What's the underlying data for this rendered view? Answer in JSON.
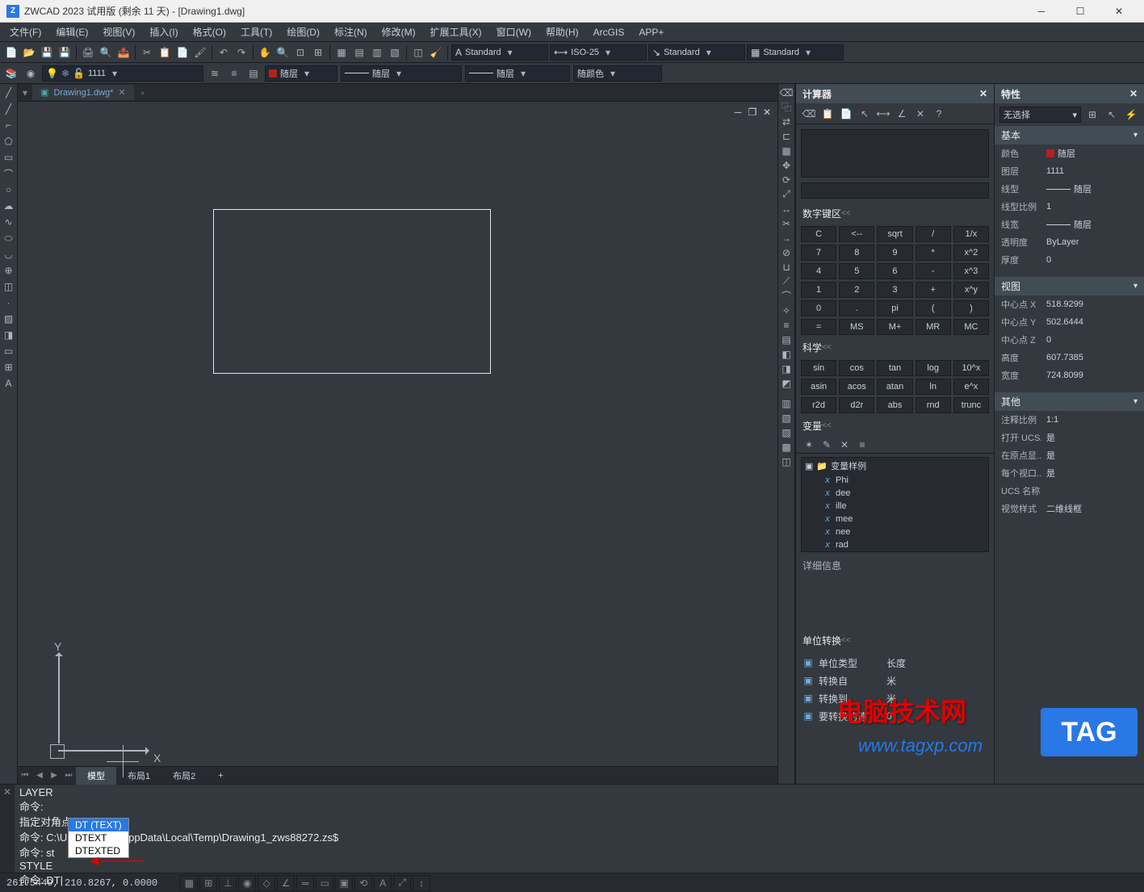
{
  "title": "ZWCAD 2023 试用版 (剩余 11 天) - [Drawing1.dwg]",
  "menus": [
    "文件(F)",
    "编辑(E)",
    "视图(V)",
    "插入(I)",
    "格式(O)",
    "工具(T)",
    "绘图(D)",
    "标注(N)",
    "修改(M)",
    "扩展工具(X)",
    "窗口(W)",
    "帮助(H)",
    "ArcGIS",
    "APP+"
  ],
  "toolbar_styles": {
    "text": "Standard",
    "dim": "ISO-25",
    "mleader": "Standard",
    "table": "Standard"
  },
  "layer_bar": {
    "layer": "1111",
    "color": "随层",
    "linetype": "随层",
    "lineweight": "随层",
    "plot": "随颜色"
  },
  "doc_tab": {
    "name": "Drawing1.dwg*"
  },
  "model_tabs": {
    "model": "模型",
    "layout1": "布局1",
    "layout2": "布局2"
  },
  "calc": {
    "title": "计算器",
    "sections": {
      "numpad": "数字键区",
      "science": "科学",
      "vars": "变量",
      "detail": "详细信息",
      "unit": "单位转换"
    },
    "keys": [
      [
        "C",
        "<--",
        "sqrt",
        "/",
        "1/x"
      ],
      [
        "7",
        "8",
        "9",
        "*",
        "x^2"
      ],
      [
        "4",
        "5",
        "6",
        "-",
        "x^3"
      ],
      [
        "1",
        "2",
        "3",
        "+",
        "x^y"
      ],
      [
        "0",
        ".",
        "pi",
        "(",
        ")"
      ],
      [
        "=",
        "MS",
        "M+",
        "MR",
        "MC"
      ]
    ],
    "sci_keys": [
      [
        "sin",
        "cos",
        "tan",
        "log",
        "10^x"
      ],
      [
        "asin",
        "acos",
        "atan",
        "ln",
        "e^x"
      ],
      [
        "r2d",
        "d2r",
        "abs",
        "rnd",
        "trunc"
      ]
    ],
    "var_tree": {
      "root": "变量样例",
      "items": [
        "Phi",
        "dee",
        "ille",
        "mee",
        "nee",
        "rad"
      ]
    },
    "unit_rows": {
      "type_label": "单位类型",
      "type_val": "长度",
      "from_label": "转换自",
      "from_val": "米",
      "to_label": "转换到",
      "to_val": "米",
      "val_label": "要转换的值",
      "val_val": "0"
    }
  },
  "props": {
    "title": "特性",
    "selector": "无选择",
    "sections": {
      "basic": {
        "title": "基本",
        "rows": [
          {
            "label": "颜色",
            "val": "随层",
            "swatch": true
          },
          {
            "label": "图层",
            "val": "1111"
          },
          {
            "label": "线型",
            "val": "随层",
            "line": true
          },
          {
            "label": "线型比例",
            "val": "1"
          },
          {
            "label": "线宽",
            "val": "随层",
            "line": true
          },
          {
            "label": "透明度",
            "val": "ByLayer"
          },
          {
            "label": "厚度",
            "val": "0"
          }
        ]
      },
      "view": {
        "title": "视图",
        "rows": [
          {
            "label": "中心点 X",
            "val": "518.9299"
          },
          {
            "label": "中心点 Y",
            "val": "502.6444"
          },
          {
            "label": "中心点 Z",
            "val": "0"
          },
          {
            "label": "高度",
            "val": "607.7385"
          },
          {
            "label": "宽度",
            "val": "724.8099"
          }
        ]
      },
      "other": {
        "title": "其他",
        "rows": [
          {
            "label": "注释比例",
            "val": "1:1"
          },
          {
            "label": "打开 UCS...",
            "val": "是"
          },
          {
            "label": "在原点显...",
            "val": "是"
          },
          {
            "label": "每个视口...",
            "val": "是"
          },
          {
            "label": "UCS 名称",
            "val": ""
          },
          {
            "label": "视觉样式",
            "val": "二维线框"
          }
        ]
      }
    }
  },
  "command": {
    "lines": [
      "LAYER",
      "命令:",
      "指定对角点:",
      "命令: C:\\Users\\admin\\AppData\\Local\\Temp\\Drawing1_zws88272.zs$",
      "命令: st",
      "STYLE"
    ],
    "autocomplete": [
      "DT (TEXT)",
      "DTEXT",
      "DTEXTED"
    ],
    "prompt": "命令: DT"
  },
  "status": {
    "coords": "261.5449, 210.8267, 0.0000"
  },
  "watermark1": "电脑技术网",
  "watermark2": "www.tagxp.com",
  "watermark_tag": "TAG"
}
